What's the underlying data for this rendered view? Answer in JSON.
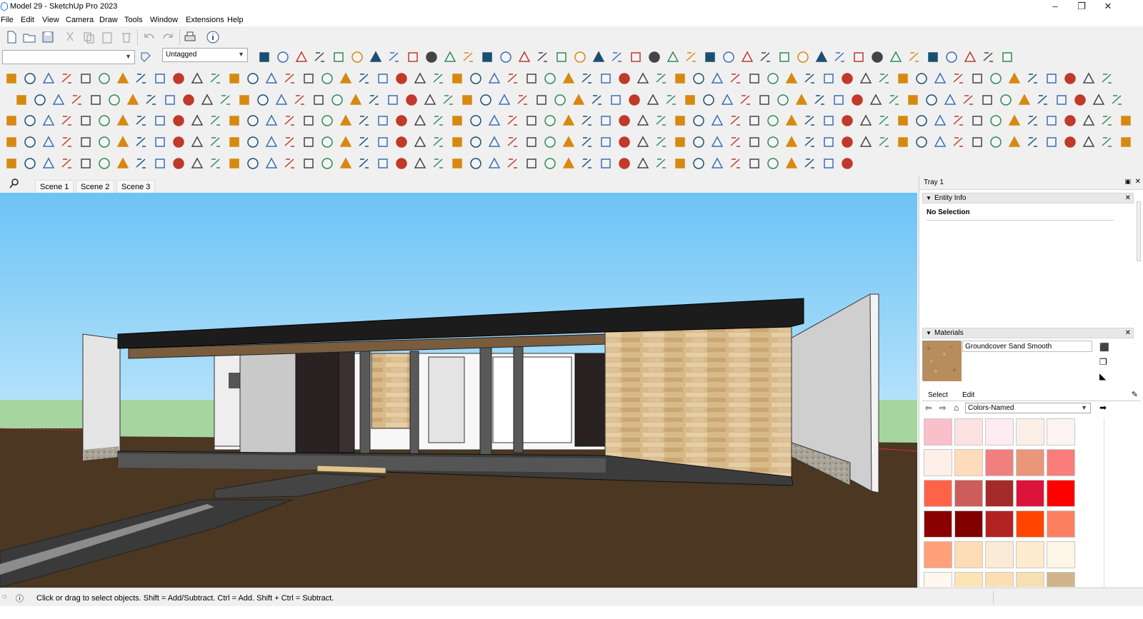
{
  "window": {
    "title": "Model 29 - SketchUp Pro 2023",
    "minimize": "–",
    "maximize": "❐",
    "close": "✕"
  },
  "menu": [
    "File",
    "Edit",
    "View",
    "Camera",
    "Draw",
    "Tools",
    "Window",
    "Extensions",
    "Help"
  ],
  "toolbar": {
    "tag_selected": "Untagged"
  },
  "scenes": [
    "Scene 1",
    "Scene 2",
    "Scene 3"
  ],
  "tray": {
    "title": "Tray 1",
    "entity_info": {
      "title": "Entity Info",
      "selection": "No Selection"
    },
    "materials": {
      "title": "Materials",
      "current_material": "Groundcover Sand Smooth",
      "tab_select": "Select",
      "tab_edit": "Edit",
      "library": "Colors-Named",
      "swatches": [
        "#f9bfcb",
        "#fce1e3",
        "#fcecf1",
        "#faefe6",
        "#fcf3f3",
        "#fdf0e9",
        "#fcdcbb",
        "#f08080",
        "#e9967a",
        "#f87d7b",
        "#ff6347",
        "#cd5c5c",
        "#a52a2a",
        "#dc143c",
        "#ff0000",
        "#8b0000",
        "#800000",
        "#b22222",
        "#ff4500",
        "#fa8060",
        "#ffa07a",
        "#fedcb5",
        "#faebd7",
        "#fdebcd",
        "#fdf5e6",
        "#fef8ee",
        "#fde4b5",
        "#fcdeb4",
        "#f5dfb3",
        "#d2b48c"
      ]
    }
  },
  "status": {
    "message": "Click or drag to select objects. Shift = Add/Subtract. Ctrl = Add. Shift + Ctrl = Subtract."
  },
  "colors": {
    "sky": "#7dc9f5",
    "ground": "#4a3621",
    "roof": "#1e1e1e",
    "wood": "#d9b98a"
  }
}
